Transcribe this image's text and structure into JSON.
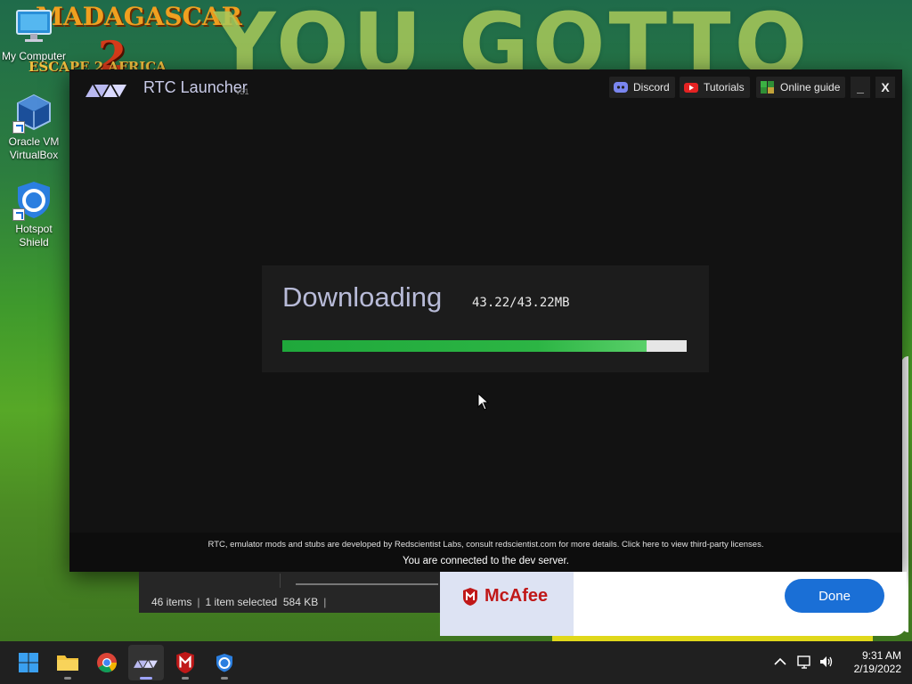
{
  "wallpaper": {
    "logo_line1": "MADAGASCAR",
    "logo_num": "2",
    "logo_line2": "ESCAPE 2 AFRICA",
    "headline": "YOU GOTTO"
  },
  "desktop_icons": [
    {
      "label": "My Computer"
    },
    {
      "label": "Oracle VM VirtualBox"
    },
    {
      "label": "Hotspot Shield"
    }
  ],
  "launcher": {
    "title": "RTC Launcher",
    "version": "v31",
    "buttons": {
      "discord": "Discord",
      "tutorials": "Tutorials",
      "online_guide": "Online guide",
      "minimize": "_",
      "close": "X"
    },
    "download": {
      "status": "Downloading",
      "size_text": "43.22/43.22MB",
      "progress_fraction": 0.9
    },
    "footer": {
      "credits": "RTC, emulator mods and stubs are developed by Redscientist Labs, consult redscientist.com for more details. Click here to view third-party licenses.",
      "connection": "You are connected to the dev server."
    }
  },
  "explorer_status": {
    "items": "46 items",
    "selected": "1 item selected",
    "size": "584 KB"
  },
  "mcafee_toast": {
    "brand": "McAfee",
    "done_label": "Done"
  },
  "taskbar": {
    "apps": [
      {
        "name": "start"
      },
      {
        "name": "file-explorer"
      },
      {
        "name": "chrome"
      },
      {
        "name": "rtc-launcher",
        "active": true
      },
      {
        "name": "mcafee"
      },
      {
        "name": "hotspot-shield"
      }
    ],
    "time": "9:31 AM",
    "date": "2/19/2022"
  },
  "colors": {
    "accent_blue": "#1a6fd6",
    "progress_green": "#2cb544",
    "mcafee_red": "#c01818",
    "launcher_bg": "#121212"
  }
}
